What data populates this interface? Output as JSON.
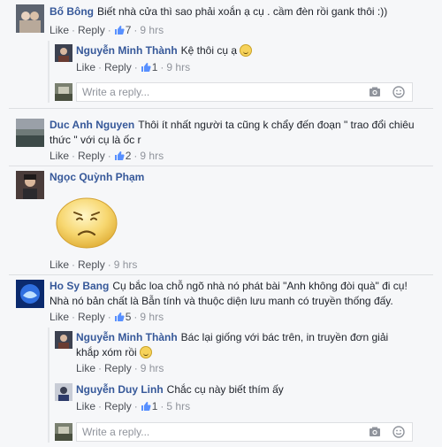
{
  "comments": [
    {
      "author": "Bố Bông",
      "text": "Biết nhà cửa thì sao phải xoắn ạ cụ . cầm đèn rồi gank thôi :))",
      "like": "Like",
      "reply": "Reply",
      "likes": "7",
      "time": "9 hrs"
    },
    {
      "author": "Nguyễn Minh Thành",
      "text": "Kệ thôi cụ ạ",
      "like": "Like",
      "reply": "Reply",
      "likes": "1",
      "time": "9 hrs"
    },
    {
      "author": "Duc Anh Nguyen",
      "text_line1": "Thôi ít nhất người ta cũng k chẩy đến đoạn \" trao đổi chiêu",
      "text_line2": "thức \" với cụ là ốc r",
      "like": "Like",
      "reply": "Reply",
      "likes": "2",
      "time": "9 hrs"
    },
    {
      "author": "Ngọc Quỳnh Phạm",
      "like": "Like",
      "reply": "Reply",
      "time": "9 hrs"
    },
    {
      "author": "Ho Sy Bang",
      "text_line1": "Cụ bắc loa chỗ ngõ nhà nó phát bài \"Anh không đòi quà\" đi cụ!",
      "text_line2": "Nhà nó bản chất là Bẫn tính và thuộc diện lưu manh có truyền thống đấy.",
      "like": "Like",
      "reply": "Reply",
      "likes": "5",
      "time": "9 hrs"
    },
    {
      "author": "Nguyễn Minh Thành",
      "text_line1": "Bác lại giống với bác trên, in truyền đơn giải",
      "text_line2": "khắp xóm rồi",
      "like": "Like",
      "reply": "Reply",
      "time": "9 hrs"
    },
    {
      "author": "Nguyễn Duy Linh",
      "text": "Chắc cụ này biết thím ấy",
      "like": "Like",
      "reply": "Reply",
      "likes": "1",
      "time": "5 hrs"
    }
  ],
  "reply_placeholder": "Write a reply...",
  "colors": {
    "name": "#365899",
    "background": "#f6f7f9",
    "like_blue": "#5890ff"
  },
  "icons": [
    "thumbs-up-icon",
    "camera-icon",
    "emoji-icon",
    "smile-emoji-icon",
    "sad-sticker-icon"
  ]
}
